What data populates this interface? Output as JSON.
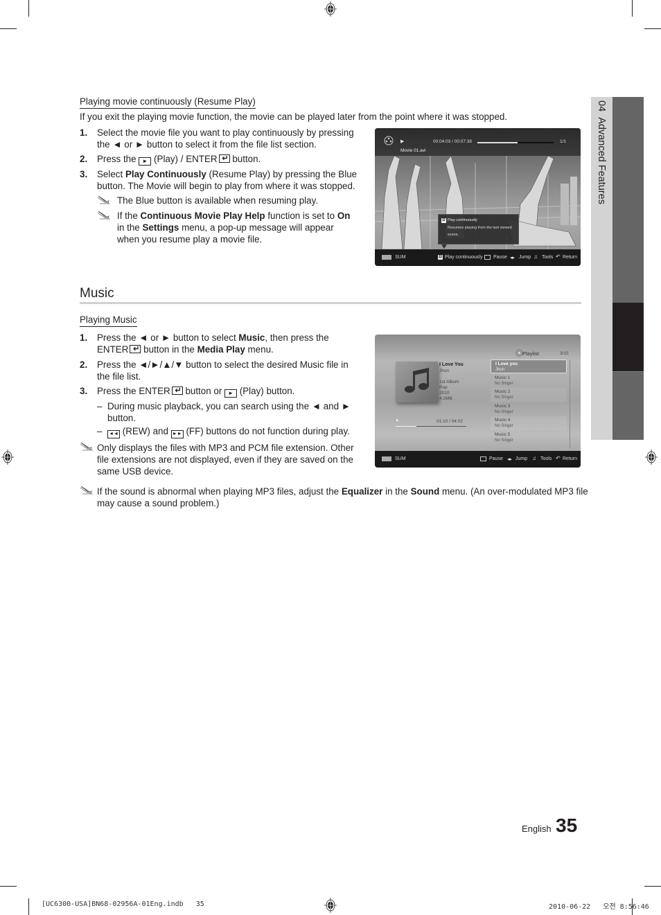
{
  "resume_section": {
    "subheading": "Playing movie continuously (Resume Play)",
    "intro": "If you exit the playing movie function, the movie can be played later from the point where it was stopped.",
    "steps": [
      {
        "num": "1.",
        "line1": "Select the movie file you want to play continuously by pressing",
        "line2": "the ◄ or ► button to select it from the file list section."
      },
      {
        "num": "2.",
        "pre": "Press the",
        "play_label": "(Play) /",
        "enter_label": "ENTER",
        "post": "button."
      },
      {
        "num": "3.",
        "pre": "Select",
        "bold": "Play Continuously",
        "post": "(Resume Play) by pressing the Blue",
        "line2": "button. The Movie will begin to play from where it was stopped."
      }
    ],
    "notes": [
      {
        "text": "The Blue button is available when resuming play."
      },
      {
        "pre": "If the",
        "bold1": "Continuous Movie Play Help",
        "mid1": "function is set to",
        "bold2": "On",
        "line2_pre": "in the",
        "bold3": "Settings",
        "line2_post": "menu, a pop-up message will appear",
        "line3": "when you resume play a movie file."
      }
    ]
  },
  "movie_screen": {
    "time": "00:04:03 / 00:07:38",
    "progress": 0.53,
    "count": "1/1",
    "filename": "Movie 01.avi",
    "popup_key": "D",
    "popup_title": "Play continuously",
    "popup_desc_1": "Resumes playing from the last viewed",
    "popup_desc_2": "scene.",
    "device": "SUM",
    "bar_items": [
      {
        "icon": "D",
        "label": "Play continuously"
      },
      {
        "icon": "enter",
        "label": "Pause"
      },
      {
        "icon": "lr-arrows",
        "label": "Jump"
      },
      {
        "icon": "tools",
        "label": "Tools"
      },
      {
        "icon": "return",
        "label": "Return"
      }
    ]
  },
  "music_section": {
    "title": "Music",
    "subheading": "Playing Music",
    "steps": [
      {
        "num": "1.",
        "pre": "Press the ◄ or ► button to select",
        "bold1": "Music",
        "post": ", then press the",
        "enter": "ENTER",
        "line2_mid": "button in the",
        "bold2": "Media Play",
        "line2_post": "menu."
      },
      {
        "num": "2.",
        "line1": "Press the ◄/►/▲/▼ button to select the desired Music file in",
        "line2": "the file list."
      },
      {
        "num": "3.",
        "pre": "Press the",
        "enter": "ENTER",
        "mid": "button or",
        "post": "(Play) button."
      }
    ],
    "dashes": [
      {
        "line1": "During music playback, you can search using the ◄ and ►",
        "line2": "button."
      },
      {
        "rew": "(REW) and",
        "ff": "(FF) buttons do not function during play."
      }
    ],
    "note1": {
      "line1": "Only displays the files with MP3 and PCM file extension. Other",
      "line2": "file extensions are not displayed, even if they are saved on the",
      "line3": "same USB device."
    },
    "note2": {
      "pre": "If the sound is abnormal when playing MP3 files, adjust the",
      "bold1": "Equalizer",
      "mid": "in the",
      "bold2": "Sound",
      "post": "menu. (An over-modulated MP3 file",
      "line2": "may cause a sound problem.)"
    }
  },
  "music_screen": {
    "playlist_label": "Playlist",
    "count": "3/15",
    "track_title": "I Love You",
    "artist": "Jhon",
    "album": "1st Album",
    "genre": "Pop",
    "year": "2010",
    "size": "4.2MB",
    "time": "01:10 / 04:02",
    "progress": 0.29,
    "playlist": [
      {
        "title": "I Love you",
        "artist": "Jhon",
        "selected": true
      },
      {
        "title": "Music 1",
        "artist": "No Singer"
      },
      {
        "title": "Music 2",
        "artist": "No Singer"
      },
      {
        "title": "Music 3",
        "artist": "No Singer"
      },
      {
        "title": "Music 4",
        "artist": "No Singer"
      },
      {
        "title": "Music 5",
        "artist": "No Singer"
      }
    ],
    "device": "SUM",
    "bar_items": [
      {
        "icon": "enter",
        "label": "Pause"
      },
      {
        "icon": "lr-arrows",
        "label": "Jump"
      },
      {
        "icon": "tools",
        "label": "Tools"
      },
      {
        "icon": "return",
        "label": "Return"
      }
    ]
  },
  "side_tab": {
    "chapter": "04",
    "label": "Advanced Features"
  },
  "footer": {
    "language": "English",
    "page_number": "35",
    "slug_left": "[UC6300-USA]BN68-02956A-01Eng.indb   35",
    "slug_right": "2010-06-22   오전 8:56:46"
  }
}
